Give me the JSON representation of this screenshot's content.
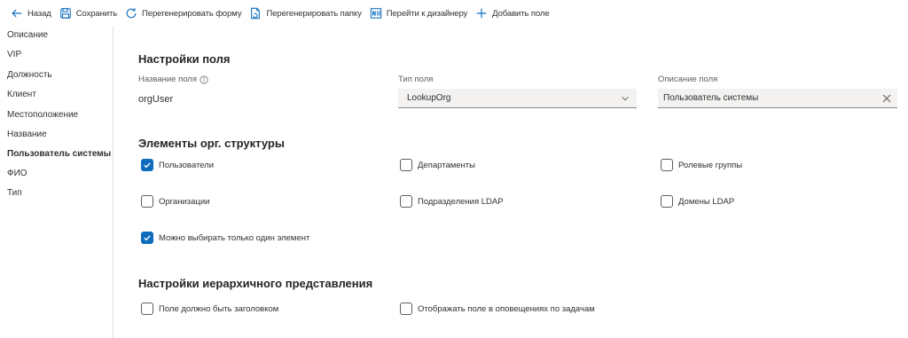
{
  "toolbar": {
    "back_label": "Назад",
    "save_label": "Сохранить",
    "regen_form_label": "Перегенерировать форму",
    "regen_folder_label": "Перегенерировать папку",
    "designer_label": "Перейти к дизайнеру",
    "add_field_label": "Добавить поле"
  },
  "sidebar": {
    "items": [
      {
        "label": "Описание"
      },
      {
        "label": "VIP"
      },
      {
        "label": "Должность"
      },
      {
        "label": "Клиент"
      },
      {
        "label": "Местоположение"
      },
      {
        "label": "Название"
      },
      {
        "label": "Пользователь системы"
      },
      {
        "label": "ФИО"
      },
      {
        "label": "Тип"
      }
    ],
    "active_index": 6
  },
  "field_settings": {
    "title": "Настройки поля",
    "name_label": "Название поля",
    "name_value": "orgUser",
    "type_label": "Тип поля",
    "type_value": "LookupOrg",
    "description_label": "Описание поля",
    "description_value": "Пользователь системы"
  },
  "org_structure": {
    "title": "Элементы орг. структуры",
    "checkboxes": [
      {
        "label": "Пользователи",
        "checked": true
      },
      {
        "label": "Департаменты",
        "checked": false
      },
      {
        "label": "Ролевые группы",
        "checked": false
      },
      {
        "label": "Организации",
        "checked": false
      },
      {
        "label": "Подразделения LDAP",
        "checked": false
      },
      {
        "label": "Домены LDAP",
        "checked": false
      },
      {
        "label": "Можно выбирать только один элемент",
        "checked": true
      }
    ]
  },
  "hierarchy": {
    "title": "Настройки иерархичного представления",
    "checkboxes": [
      {
        "label": "Поле должно быть заголовком",
        "checked": false
      },
      {
        "label": "Отображать поле в оповещениях по задачам",
        "checked": false
      }
    ]
  },
  "colors": {
    "accent": "#0f6cbd",
    "text": "#323130",
    "muted": "#605e5c",
    "input_bg": "#f3f2f1"
  },
  "icons": {
    "back": "arrow-left-icon",
    "save": "save-icon",
    "regen_form": "refresh-icon",
    "regen_folder": "folder-refresh-icon",
    "designer": "designer-icon",
    "add": "plus-icon",
    "info": "info-icon",
    "chevron": "chevron-down-icon",
    "clear": "close-icon",
    "check": "checkmark-icon"
  }
}
